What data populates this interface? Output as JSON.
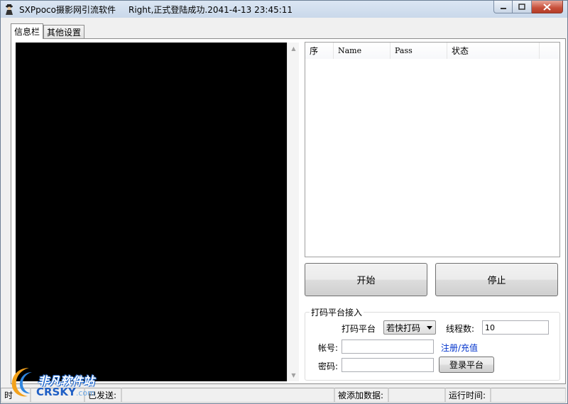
{
  "window": {
    "app_title": "SXPpoco摄影网引流软件",
    "status_title": "Right,正式登陆成功.2041-4-13 23:45:11"
  },
  "tabs": [
    {
      "label": "信息栏",
      "active": true
    },
    {
      "label": "其他设置",
      "active": false
    }
  ],
  "list": {
    "columns": [
      "序",
      "Name",
      "Pass",
      "状态"
    ]
  },
  "buttons": {
    "start": "开始",
    "stop": "停止"
  },
  "captcha_group": {
    "title": "打码平台接入",
    "platform_label": "打码平台",
    "platform_selected": "若快打码",
    "threads_label": "线程数:",
    "threads_value": "10",
    "account_label": "帐号:",
    "account_value": "",
    "register_link": "注册/充值",
    "password_label": "密码:",
    "password_value": "",
    "login_button": "登录平台"
  },
  "statusbar": {
    "cell1": "时",
    "sent_label": "已发送:",
    "added_label": "被添加数据:",
    "runtime_label": "运行时间:"
  },
  "watermark": {
    "cn": "非凡软件站",
    "en": "CRSKY",
    "en_suffix": ".com"
  },
  "icons": {
    "app": "spy-figure-icon",
    "minimize": "minimize-icon",
    "maximize": "maximize-icon",
    "close": "close-icon"
  }
}
